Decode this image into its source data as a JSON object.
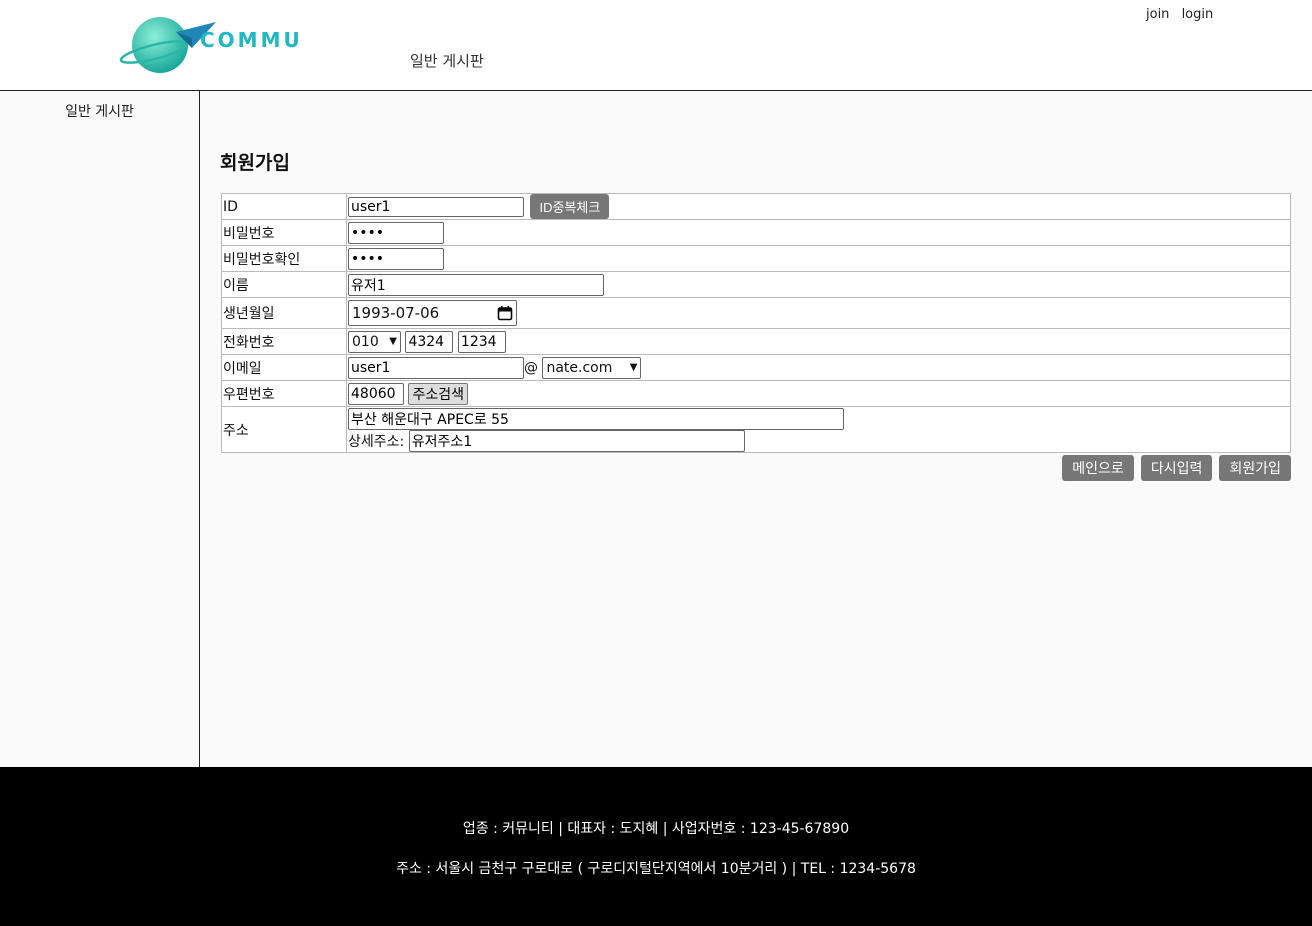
{
  "header": {
    "logo_text": "COMMU",
    "nav_board": "일반 게시판",
    "join": "join",
    "login": "login"
  },
  "sidebar": {
    "items": [
      {
        "label": "일반 게시판"
      }
    ]
  },
  "page_title": "회원가입",
  "form": {
    "id_label": "ID",
    "id_value": "user1",
    "id_check_button": "ID중복체크",
    "password_label": "비밀번호",
    "password_value": "••••",
    "password_confirm_label": "비밀번호확인",
    "password_confirm_value": "••••",
    "name_label": "이름",
    "name_value": "유저1",
    "birth_label": "생년월일",
    "birth_value": "1993-07-06",
    "phone_label": "전화번호",
    "phone_prefix": "010",
    "phone_mid": "4324",
    "phone_last": "1234",
    "email_label": "이메일",
    "email_local": "user1",
    "email_at": "@",
    "email_domain": "nate.com",
    "zip_label": "우편번호",
    "zip_value": "48060",
    "zip_search_button": "주소검색",
    "address_label": "주소",
    "address_value": "부산 해운대구 APEC로 55",
    "detail_label": "상세주소:",
    "detail_value": "유저주소1"
  },
  "actions": {
    "main": "메인으로",
    "reset": "다시입력",
    "submit": "회원가입"
  },
  "footer": {
    "line1": "업종 : 커뮤니티  |  대표자 : 도지혜  |  사업자번호 : 123-45-67890",
    "line2": "주소 : 서울시 금천구 구로대로 ( 구로디지털단지역에서 10분거리 )  |  TEL : 1234-5678"
  },
  "colors": {
    "logo_accent": "#20b8c5",
    "button_gray": "#777777",
    "footer_bg": "#000000"
  }
}
